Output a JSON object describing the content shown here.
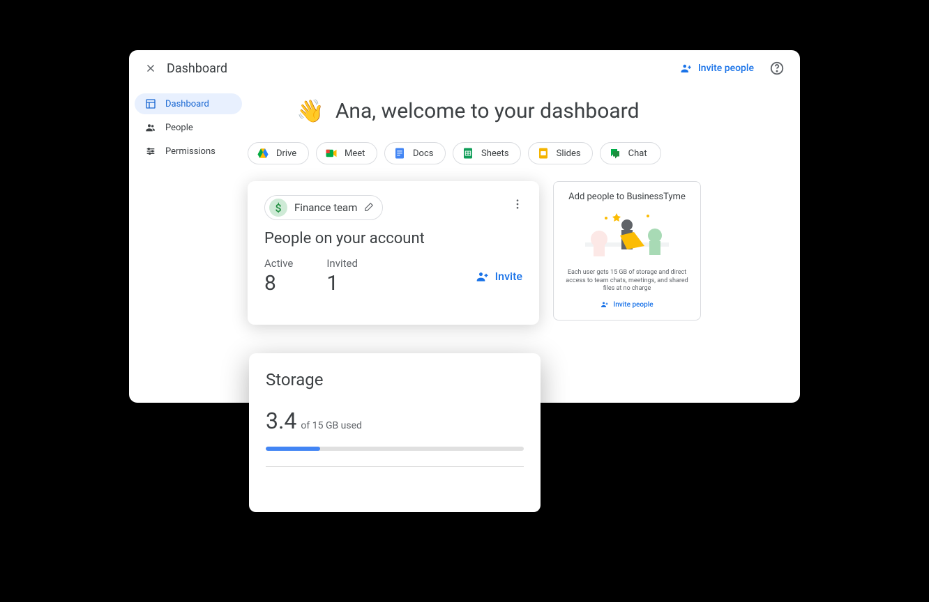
{
  "header": {
    "title": "Dashboard",
    "invite_label": "Invite people"
  },
  "sidebar": {
    "items": [
      {
        "label": "Dashboard"
      },
      {
        "label": "People"
      },
      {
        "label": "Permissions"
      }
    ]
  },
  "welcome": {
    "emoji": "👋",
    "text": "Ana, welcome to your dashboard"
  },
  "chips": [
    {
      "label": "Drive"
    },
    {
      "label": "Meet"
    },
    {
      "label": "Docs"
    },
    {
      "label": "Sheets"
    },
    {
      "label": "Slides"
    },
    {
      "label": "Chat"
    }
  ],
  "people_card": {
    "team_name": "Finance team",
    "title": "People on your account",
    "active_label": "Active",
    "active_count": "8",
    "invited_label": "Invited",
    "invited_count": "1",
    "invite_button": "Invite"
  },
  "promo_card": {
    "title": "Add people to BusinessTyme",
    "description": "Each user gets 15 GB of storage and direct access to team chats, meetings, and shared files at no charge",
    "link": "Invite people"
  },
  "storage_card": {
    "title": "Storage",
    "used": "3.4",
    "of_total": "of 15 GB used",
    "percent": 21
  },
  "colors": {
    "primary": "#1a73e8",
    "text": "#3c4043",
    "muted": "#5f6368"
  }
}
